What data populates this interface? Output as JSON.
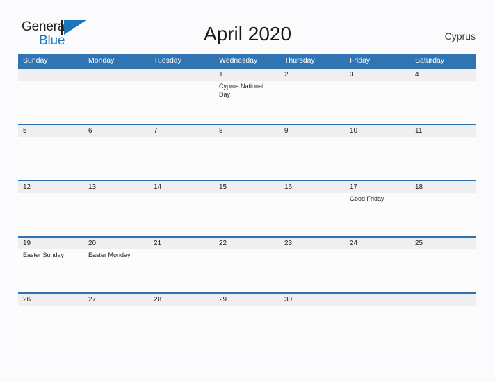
{
  "brand": {
    "name_part1": "General",
    "name_part2": "Blue",
    "logo_icon": "flag-triangle-icon"
  },
  "header": {
    "title": "April 2020",
    "country": "Cyprus"
  },
  "colors": {
    "header_blue": "#3074B4",
    "row_divider_blue": "#2F72B2",
    "band_gray": "#EFEFEF",
    "page_background": "#FBFBFD",
    "logo_blue": "#1878C4",
    "text": "#222222"
  },
  "calendar": {
    "month": "April",
    "year": "2020",
    "weekday_headers": [
      "Sunday",
      "Monday",
      "Tuesday",
      "Wednesday",
      "Thursday",
      "Friday",
      "Saturday"
    ],
    "weeks": [
      [
        {
          "day": "",
          "event": ""
        },
        {
          "day": "",
          "event": ""
        },
        {
          "day": "",
          "event": ""
        },
        {
          "day": "1",
          "event": "Cyprus National Day"
        },
        {
          "day": "2",
          "event": ""
        },
        {
          "day": "3",
          "event": ""
        },
        {
          "day": "4",
          "event": ""
        }
      ],
      [
        {
          "day": "5",
          "event": ""
        },
        {
          "day": "6",
          "event": ""
        },
        {
          "day": "7",
          "event": ""
        },
        {
          "day": "8",
          "event": ""
        },
        {
          "day": "9",
          "event": ""
        },
        {
          "day": "10",
          "event": ""
        },
        {
          "day": "11",
          "event": ""
        }
      ],
      [
        {
          "day": "12",
          "event": ""
        },
        {
          "day": "13",
          "event": ""
        },
        {
          "day": "14",
          "event": ""
        },
        {
          "day": "15",
          "event": ""
        },
        {
          "day": "16",
          "event": ""
        },
        {
          "day": "17",
          "event": "Good Friday"
        },
        {
          "day": "18",
          "event": ""
        }
      ],
      [
        {
          "day": "19",
          "event": "Easter Sunday"
        },
        {
          "day": "20",
          "event": "Easter Monday"
        },
        {
          "day": "21",
          "event": ""
        },
        {
          "day": "22",
          "event": ""
        },
        {
          "day": "23",
          "event": ""
        },
        {
          "day": "24",
          "event": ""
        },
        {
          "day": "25",
          "event": ""
        }
      ],
      [
        {
          "day": "26",
          "event": ""
        },
        {
          "day": "27",
          "event": ""
        },
        {
          "day": "28",
          "event": ""
        },
        {
          "day": "29",
          "event": ""
        },
        {
          "day": "30",
          "event": ""
        },
        {
          "day": "",
          "event": ""
        },
        {
          "day": "",
          "event": ""
        }
      ]
    ]
  }
}
